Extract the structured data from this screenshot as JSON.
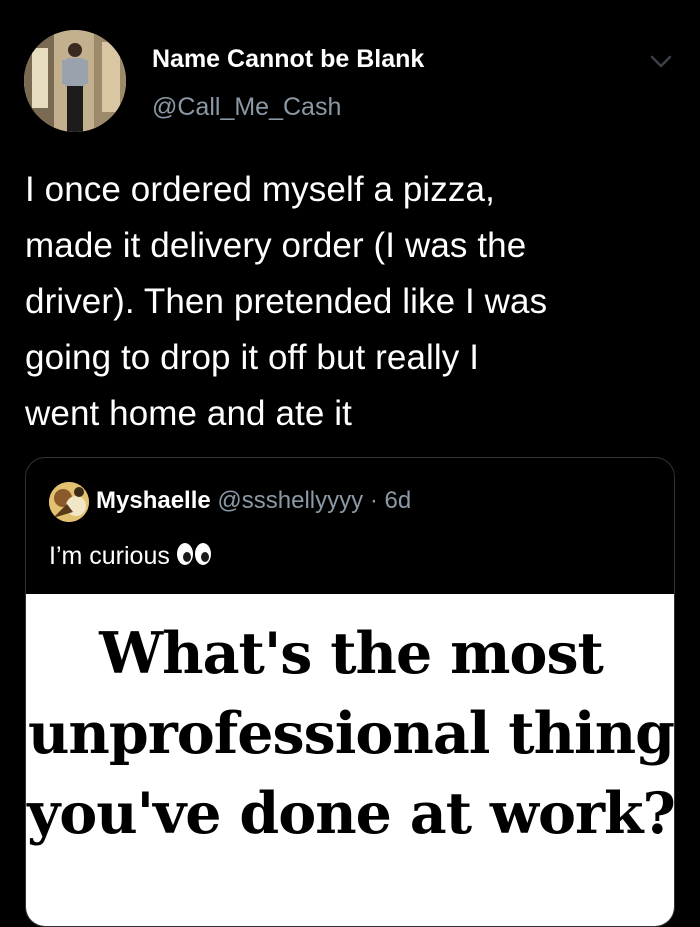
{
  "tweet": {
    "display_name": "Name Cannot be Blank",
    "handle": "@Call_Me_Cash",
    "text_lines": [
      "I once ordered myself a pizza,",
      "made it delivery order (I was the",
      "driver). Then pretended like I was",
      "going to drop it off but really I",
      "went home and ate it"
    ],
    "avatar_icon": "profile-photo",
    "menu_icon": "chevron-down-icon"
  },
  "quoted_tweet": {
    "display_name": "Myshaelle",
    "handle": "@ssshellyyyy",
    "separator": "·",
    "time": "6d",
    "text": "I’m curious",
    "emoji_icon": "eyes-emoji-icon",
    "media_lines": [
      "What's the most",
      "unprofessional thing",
      "you've done at work?"
    ]
  },
  "colors": {
    "background": "#000000",
    "text_primary": "#ffffff",
    "text_secondary": "#8b98a5",
    "border": "#2f3336",
    "media_background": "#ffffff"
  }
}
